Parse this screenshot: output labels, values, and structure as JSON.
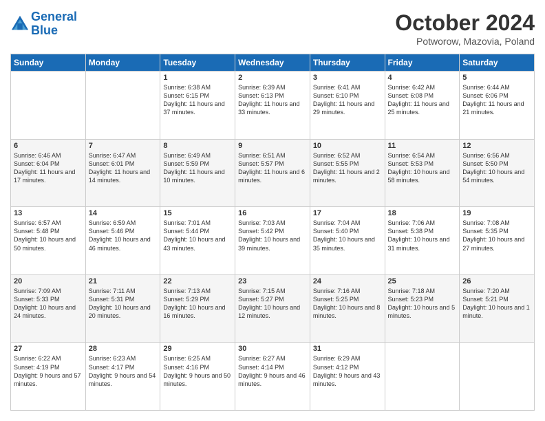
{
  "header": {
    "logo_line1": "General",
    "logo_line2": "Blue",
    "month_title": "October 2024",
    "location": "Potworow, Mazovia, Poland"
  },
  "days_of_week": [
    "Sunday",
    "Monday",
    "Tuesday",
    "Wednesday",
    "Thursday",
    "Friday",
    "Saturday"
  ],
  "weeks": [
    [
      {
        "day": "",
        "sunrise": "",
        "sunset": "",
        "daylight": ""
      },
      {
        "day": "",
        "sunrise": "",
        "sunset": "",
        "daylight": ""
      },
      {
        "day": "1",
        "sunrise": "Sunrise: 6:38 AM",
        "sunset": "Sunset: 6:15 PM",
        "daylight": "Daylight: 11 hours and 37 minutes."
      },
      {
        "day": "2",
        "sunrise": "Sunrise: 6:39 AM",
        "sunset": "Sunset: 6:13 PM",
        "daylight": "Daylight: 11 hours and 33 minutes."
      },
      {
        "day": "3",
        "sunrise": "Sunrise: 6:41 AM",
        "sunset": "Sunset: 6:10 PM",
        "daylight": "Daylight: 11 hours and 29 minutes."
      },
      {
        "day": "4",
        "sunrise": "Sunrise: 6:42 AM",
        "sunset": "Sunset: 6:08 PM",
        "daylight": "Daylight: 11 hours and 25 minutes."
      },
      {
        "day": "5",
        "sunrise": "Sunrise: 6:44 AM",
        "sunset": "Sunset: 6:06 PM",
        "daylight": "Daylight: 11 hours and 21 minutes."
      }
    ],
    [
      {
        "day": "6",
        "sunrise": "Sunrise: 6:46 AM",
        "sunset": "Sunset: 6:04 PM",
        "daylight": "Daylight: 11 hours and 17 minutes."
      },
      {
        "day": "7",
        "sunrise": "Sunrise: 6:47 AM",
        "sunset": "Sunset: 6:01 PM",
        "daylight": "Daylight: 11 hours and 14 minutes."
      },
      {
        "day": "8",
        "sunrise": "Sunrise: 6:49 AM",
        "sunset": "Sunset: 5:59 PM",
        "daylight": "Daylight: 11 hours and 10 minutes."
      },
      {
        "day": "9",
        "sunrise": "Sunrise: 6:51 AM",
        "sunset": "Sunset: 5:57 PM",
        "daylight": "Daylight: 11 hours and 6 minutes."
      },
      {
        "day": "10",
        "sunrise": "Sunrise: 6:52 AM",
        "sunset": "Sunset: 5:55 PM",
        "daylight": "Daylight: 11 hours and 2 minutes."
      },
      {
        "day": "11",
        "sunrise": "Sunrise: 6:54 AM",
        "sunset": "Sunset: 5:53 PM",
        "daylight": "Daylight: 10 hours and 58 minutes."
      },
      {
        "day": "12",
        "sunrise": "Sunrise: 6:56 AM",
        "sunset": "Sunset: 5:50 PM",
        "daylight": "Daylight: 10 hours and 54 minutes."
      }
    ],
    [
      {
        "day": "13",
        "sunrise": "Sunrise: 6:57 AM",
        "sunset": "Sunset: 5:48 PM",
        "daylight": "Daylight: 10 hours and 50 minutes."
      },
      {
        "day": "14",
        "sunrise": "Sunrise: 6:59 AM",
        "sunset": "Sunset: 5:46 PM",
        "daylight": "Daylight: 10 hours and 46 minutes."
      },
      {
        "day": "15",
        "sunrise": "Sunrise: 7:01 AM",
        "sunset": "Sunset: 5:44 PM",
        "daylight": "Daylight: 10 hours and 43 minutes."
      },
      {
        "day": "16",
        "sunrise": "Sunrise: 7:03 AM",
        "sunset": "Sunset: 5:42 PM",
        "daylight": "Daylight: 10 hours and 39 minutes."
      },
      {
        "day": "17",
        "sunrise": "Sunrise: 7:04 AM",
        "sunset": "Sunset: 5:40 PM",
        "daylight": "Daylight: 10 hours and 35 minutes."
      },
      {
        "day": "18",
        "sunrise": "Sunrise: 7:06 AM",
        "sunset": "Sunset: 5:38 PM",
        "daylight": "Daylight: 10 hours and 31 minutes."
      },
      {
        "day": "19",
        "sunrise": "Sunrise: 7:08 AM",
        "sunset": "Sunset: 5:35 PM",
        "daylight": "Daylight: 10 hours and 27 minutes."
      }
    ],
    [
      {
        "day": "20",
        "sunrise": "Sunrise: 7:09 AM",
        "sunset": "Sunset: 5:33 PM",
        "daylight": "Daylight: 10 hours and 24 minutes."
      },
      {
        "day": "21",
        "sunrise": "Sunrise: 7:11 AM",
        "sunset": "Sunset: 5:31 PM",
        "daylight": "Daylight: 10 hours and 20 minutes."
      },
      {
        "day": "22",
        "sunrise": "Sunrise: 7:13 AM",
        "sunset": "Sunset: 5:29 PM",
        "daylight": "Daylight: 10 hours and 16 minutes."
      },
      {
        "day": "23",
        "sunrise": "Sunrise: 7:15 AM",
        "sunset": "Sunset: 5:27 PM",
        "daylight": "Daylight: 10 hours and 12 minutes."
      },
      {
        "day": "24",
        "sunrise": "Sunrise: 7:16 AM",
        "sunset": "Sunset: 5:25 PM",
        "daylight": "Daylight: 10 hours and 8 minutes."
      },
      {
        "day": "25",
        "sunrise": "Sunrise: 7:18 AM",
        "sunset": "Sunset: 5:23 PM",
        "daylight": "Daylight: 10 hours and 5 minutes."
      },
      {
        "day": "26",
        "sunrise": "Sunrise: 7:20 AM",
        "sunset": "Sunset: 5:21 PM",
        "daylight": "Daylight: 10 hours and 1 minute."
      }
    ],
    [
      {
        "day": "27",
        "sunrise": "Sunrise: 6:22 AM",
        "sunset": "Sunset: 4:19 PM",
        "daylight": "Daylight: 9 hours and 57 minutes."
      },
      {
        "day": "28",
        "sunrise": "Sunrise: 6:23 AM",
        "sunset": "Sunset: 4:17 PM",
        "daylight": "Daylight: 9 hours and 54 minutes."
      },
      {
        "day": "29",
        "sunrise": "Sunrise: 6:25 AM",
        "sunset": "Sunset: 4:16 PM",
        "daylight": "Daylight: 9 hours and 50 minutes."
      },
      {
        "day": "30",
        "sunrise": "Sunrise: 6:27 AM",
        "sunset": "Sunset: 4:14 PM",
        "daylight": "Daylight: 9 hours and 46 minutes."
      },
      {
        "day": "31",
        "sunrise": "Sunrise: 6:29 AM",
        "sunset": "Sunset: 4:12 PM",
        "daylight": "Daylight: 9 hours and 43 minutes."
      },
      {
        "day": "",
        "sunrise": "",
        "sunset": "",
        "daylight": ""
      },
      {
        "day": "",
        "sunrise": "",
        "sunset": "",
        "daylight": ""
      }
    ]
  ]
}
